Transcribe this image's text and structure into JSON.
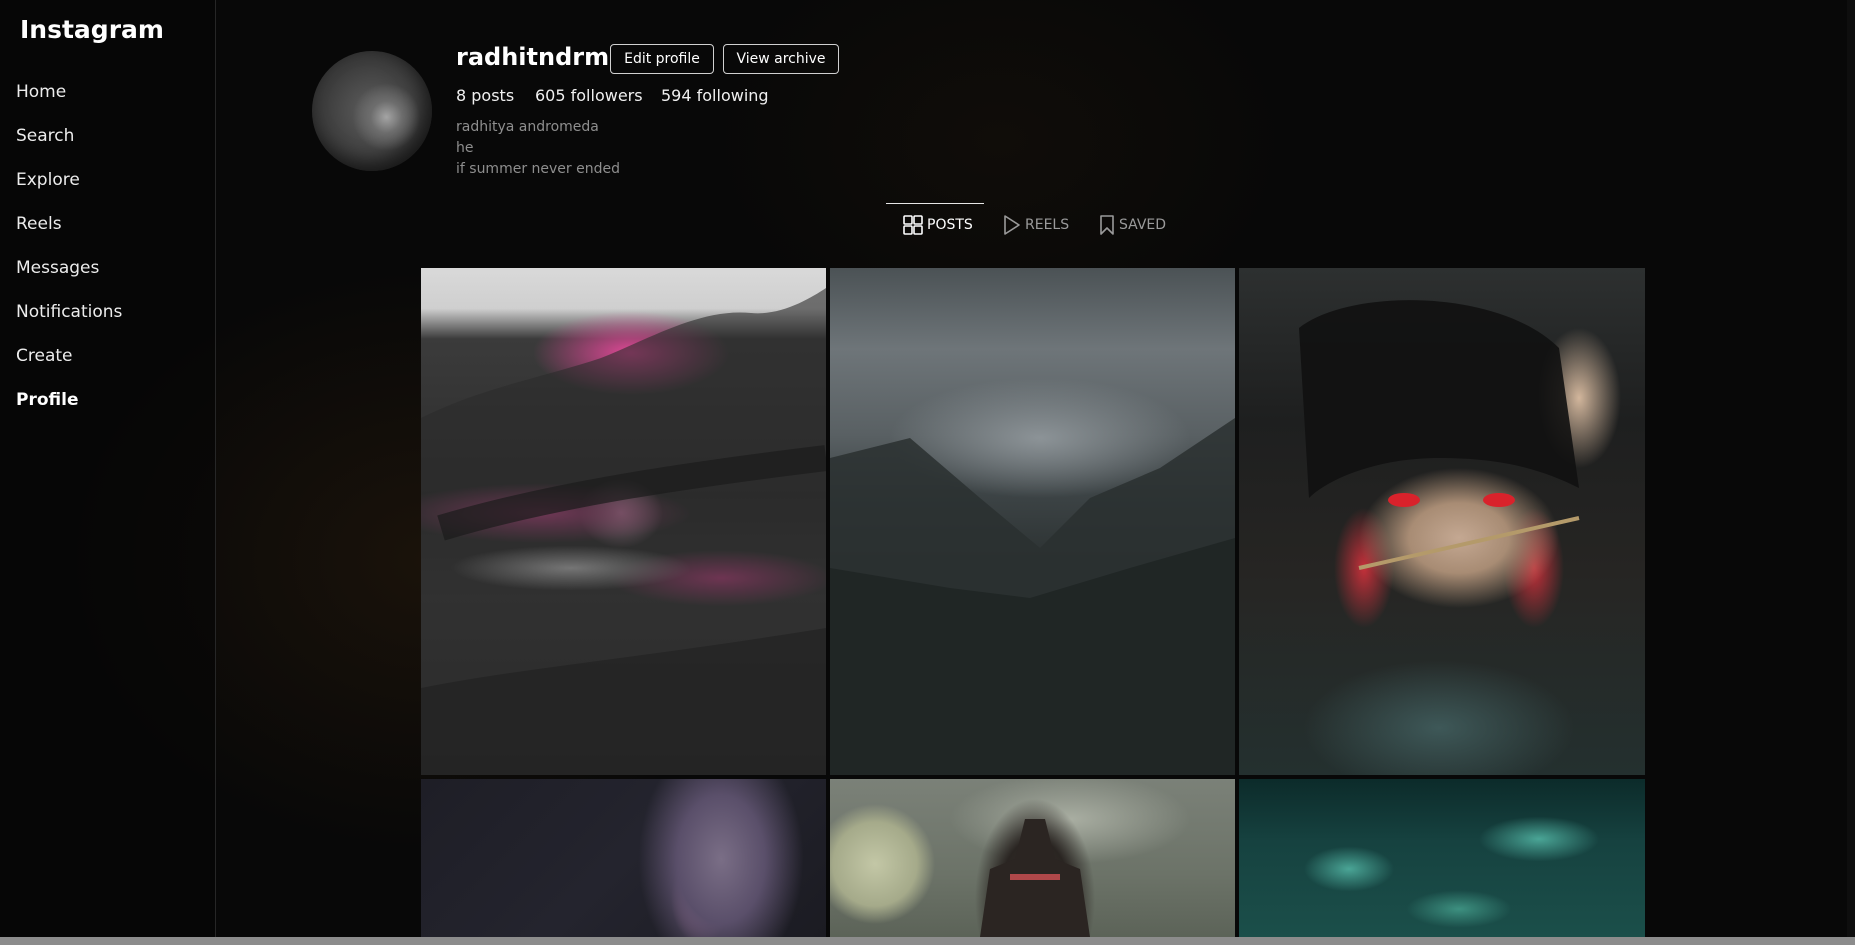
{
  "app": {
    "name": "Instagram"
  },
  "sidebar": {
    "items": [
      {
        "label": "Home"
      },
      {
        "label": "Search"
      },
      {
        "label": "Explore"
      },
      {
        "label": "Reels"
      },
      {
        "label": "Messages"
      },
      {
        "label": "Notifications"
      },
      {
        "label": "Create"
      },
      {
        "label": "Profile",
        "active": true
      }
    ]
  },
  "profile": {
    "username": "radhitndrm",
    "edit_label": "Edit profile",
    "archive_label": "View archive",
    "stats": {
      "posts": "8 posts",
      "followers": "605 followers",
      "following": "594 following"
    },
    "bio": {
      "name": "radhitya andromeda",
      "pronouns": "he",
      "text": "if summer never ended"
    }
  },
  "tabs": [
    {
      "label": "POSTS",
      "icon": "grid-icon",
      "active": true
    },
    {
      "label": "REELS",
      "icon": "play-icon"
    },
    {
      "label": "SAVED",
      "icon": "bookmark-icon"
    }
  ],
  "posts": {
    "count_visible": 6,
    "items": [
      {
        "desc": "pink forest painting"
      },
      {
        "desc": "foggy mountains"
      },
      {
        "desc": "anime character with snake"
      },
      {
        "desc": "abstract marble"
      },
      {
        "desc": "pagoda and moon"
      },
      {
        "desc": "teal water lilies"
      }
    ]
  },
  "colors": {
    "background": "#080808",
    "text": "#f2f2f2",
    "muted": "#8e8e8e",
    "border": "#d0d0d0"
  }
}
